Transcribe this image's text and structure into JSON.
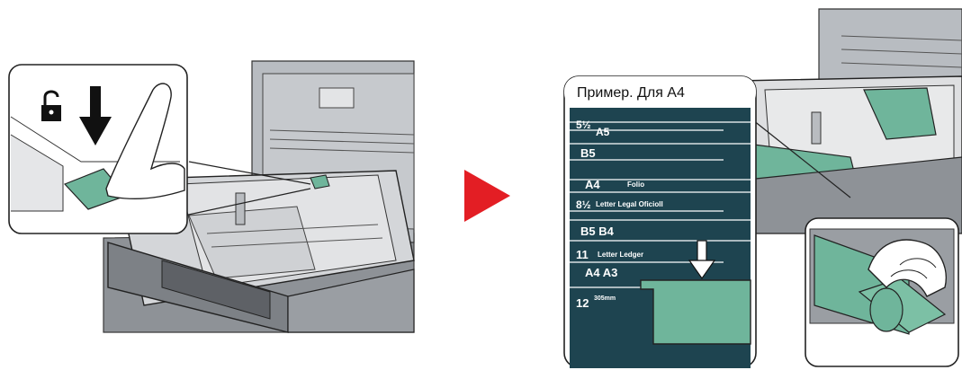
{
  "callout": {
    "title": "Пример. Для А4"
  },
  "size_scale": {
    "rows": [
      {
        "num": "5½",
        "labels": "A5"
      },
      {
        "num": "",
        "labels": "B5"
      },
      {
        "num": "",
        "labels": "A4"
      },
      {
        "num": "",
        "labels": "Folio"
      },
      {
        "num": "8½",
        "labels": "Letter Legal OficioII"
      },
      {
        "num": "",
        "labels": "B5 B4"
      },
      {
        "num": "11",
        "labels": "Letter Ledger"
      },
      {
        "num": "",
        "labels": "A4 A3"
      },
      {
        "num": "12",
        "labels": "305mm"
      }
    ]
  },
  "colors": {
    "arrow": "#e31e24",
    "green_part": "#6fb59b",
    "scale_bg": "#1e4450",
    "machine_gray": "#a9acb0"
  },
  "icons": {
    "unlock": "unlock-icon",
    "press_down": "down-arrow-icon",
    "next_step": "play-arrow-icon"
  }
}
